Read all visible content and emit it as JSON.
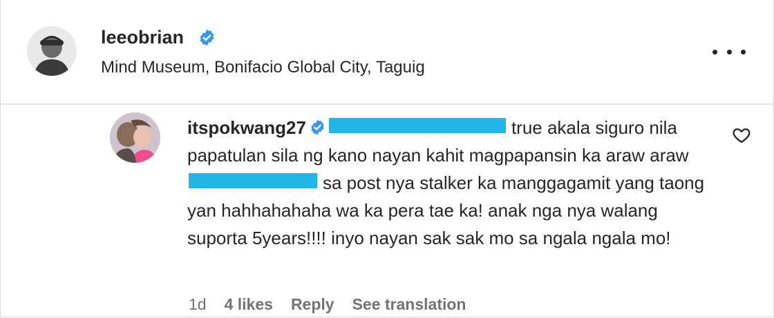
{
  "post": {
    "username": "leeobrian",
    "verified": true,
    "location": "Mind Museum, Bonifacio Global City, Taguig",
    "more_icon": "more-horizontal-icon"
  },
  "comment": {
    "username": "itspokwang27",
    "verified": true,
    "text_1": "true akala siguro nila papatulan sila ng kano nayan kahit magpapansin ka araw araw",
    "text_2": "sa post nya stalker ka manggagamit yang taong yan hahhahahaha wa ka pera tae ka! anak nga nya walang suporta 5years!!!! inyo nayan sak sak mo sa ngala ngala mo!",
    "mention_1_redacted": true,
    "mention_1_prefix": "@",
    "mention_2_redacted": true,
    "mention_2_prefix": "@",
    "redaction_color": "#22b5e8",
    "time": "1d",
    "likes": "4 likes",
    "reply_label": "Reply",
    "translate_label": "See translation",
    "like_icon": "heart-outline-icon"
  },
  "colors": {
    "verified_badge": "#3897f0",
    "text_primary": "#262626",
    "text_secondary": "#737373",
    "divider": "#e6e6e6"
  }
}
